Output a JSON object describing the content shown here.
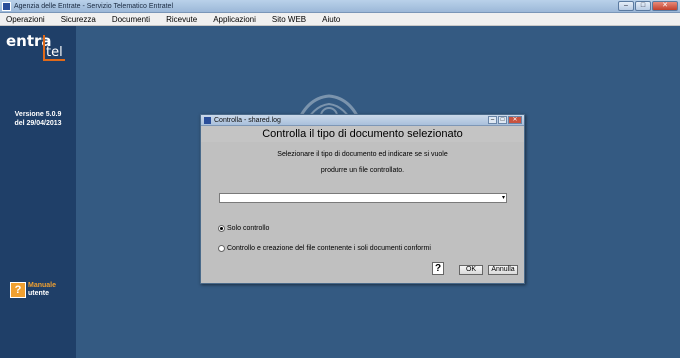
{
  "window": {
    "title": "Agenzia delle Entrate - Servizio Telematico Entratel",
    "controls": {
      "minimize": "–",
      "maximize": "□",
      "close": "✕"
    }
  },
  "menu": [
    {
      "label": "Operazioni"
    },
    {
      "label": "Sicurezza"
    },
    {
      "label": "Documenti"
    },
    {
      "label": "Ricevute"
    },
    {
      "label": "Applicazioni"
    },
    {
      "label": "Sito WEB"
    },
    {
      "label": "Aiuto"
    }
  ],
  "sidebar": {
    "logo_part1": "entra",
    "logo_part2": "tel",
    "version_line1": "Versione 5.0.9",
    "version_line2": "del 29/04/2013",
    "manual_line1": "Manuale",
    "manual_line2": "utente",
    "manual_icon": "?"
  },
  "dialog": {
    "title": "Controlla - shared.log",
    "controls": {
      "minimize": "–",
      "maximize": "□",
      "close": "✕"
    },
    "heading": "Controlla il tipo di documento selezionato",
    "description_line1": "Selezionare il tipo di documento ed indicare se si vuole",
    "description_line2": "produrre un file controllato.",
    "document_type_value": "",
    "combo_arrow": "▾",
    "options": [
      {
        "label": "Solo controllo",
        "selected": true
      },
      {
        "label": "Controllo e creazione del file contenente i soli documenti conformi",
        "selected": false
      }
    ],
    "help_label": "?",
    "ok_label": "OK",
    "cancel_label": "Annulla"
  },
  "colors": {
    "background": "#345a82",
    "sidebar": "#1f3f68",
    "accent": "#e06a1a",
    "dialog": "#c0c0c0"
  }
}
